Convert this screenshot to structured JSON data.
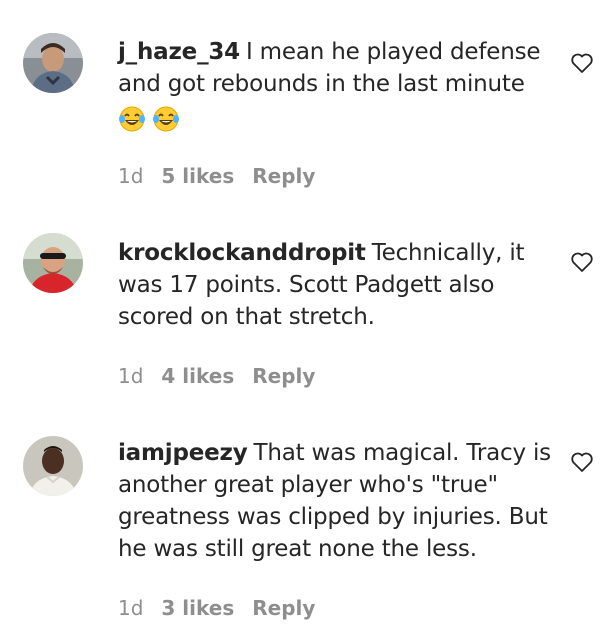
{
  "comments": [
    {
      "username": "j_haze_34",
      "text": "I mean he played defense and got rebounds in the last minute",
      "emojis": [
        "face-with-tears-of-joy",
        "face-with-tears-of-joy"
      ],
      "time": "1d",
      "likes": "5 likes",
      "reply": "Reply"
    },
    {
      "username": "krocklockanddropit",
      "text": "Technically, it was 17 points. Scott Padgett also scored on that stretch.",
      "time": "1d",
      "likes": "4 likes",
      "reply": "Reply"
    },
    {
      "username": "iamjpeezy",
      "text": "That was magical. Tracy is another great player who's \"true\" greatness was clipped by injuries. But he was still great none the less.",
      "time": "1d",
      "likes": "3 likes",
      "reply": "Reply"
    }
  ]
}
